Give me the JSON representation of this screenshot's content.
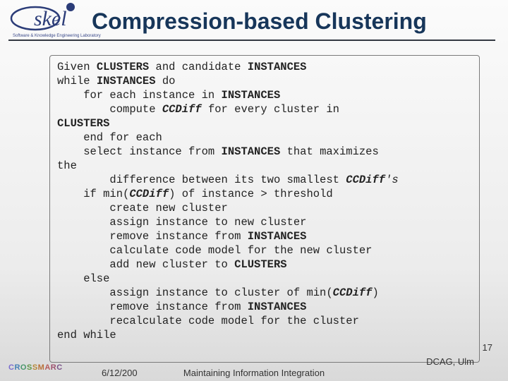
{
  "title": "Compression-based Clustering",
  "logo_caption": "Software & Knowledge Engineering Laboratory",
  "algorithm_html": "Given <span class='b'>CLUSTERS</span> and candidate <span class='b'>INSTANCES</span>\nwhile <span class='b'>INSTANCES</span> do\n    for each instance in <span class='b'>INSTANCES</span>\n        compute <span class='bi'>CCDiff</span> for every cluster in\n<span class='b'>CLUSTERS</span>\n    end for each\n    select instance from <span class='b'>INSTANCES</span> that maximizes\nthe\n        difference between its two smallest <span class='bi'>CCDiff</span><span class='i'>'s</span>\n    if min(<span class='bi'>CCDiff</span>) of instance > threshold\n        create new cluster\n        assign instance to new cluster\n        remove instance from <span class='b'>INSTANCES</span>\n        calculate code model for the new cluster\n        add new cluster to <span class='b'>CLUSTERS</span>\n    else\n        assign instance to cluster of min(<span class='bi'>CCDiff</span>)\n        remove instance from <span class='b'>INSTANCES</span>\n        recalculate code model for the cluster\nend while",
  "footer": {
    "date": "6/12/200",
    "center": "Maintaining Information Integration",
    "right": "DCAG, Ulm",
    "slide_number": "17",
    "crossmarc": "CROSSMARC"
  }
}
